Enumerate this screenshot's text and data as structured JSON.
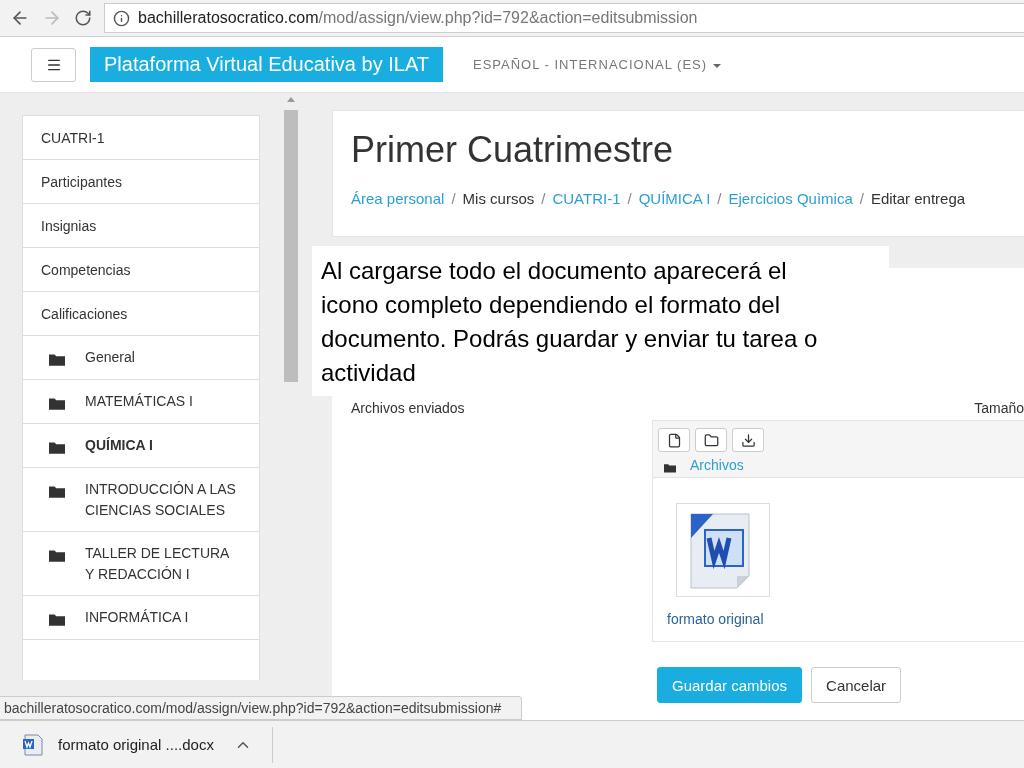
{
  "browser": {
    "url_host": "bachilleratosocratico.com",
    "url_path": "/mod/assign/view.php?id=792&action=editsubmission"
  },
  "header": {
    "site_title": "Plataforma Virtual Educativa by ILAT",
    "language": "ESPAÑOL - INTERNACIONAL (ES)"
  },
  "sidebar": {
    "items": [
      {
        "label": "CUATRI-1",
        "kind": "link",
        "selected": false
      },
      {
        "label": "Participantes",
        "kind": "link",
        "selected": false
      },
      {
        "label": "Insignias",
        "kind": "link",
        "selected": false
      },
      {
        "label": "Competencias",
        "kind": "link",
        "selected": false
      },
      {
        "label": "Calificaciones",
        "kind": "link",
        "selected": false
      },
      {
        "label": "General",
        "kind": "course",
        "selected": false
      },
      {
        "label": "MATEMÁTICAS I",
        "kind": "course",
        "selected": false
      },
      {
        "label": "QUÍMICA I",
        "kind": "course",
        "selected": true
      },
      {
        "label": "INTRODUCCIÓN A LAS CIENCIAS SOCIALES",
        "kind": "course",
        "selected": false
      },
      {
        "label": "TALLER DE LECTURA Y REDACCIÓN I",
        "kind": "course",
        "selected": false
      },
      {
        "label": "INFORMÁTICA I",
        "kind": "course",
        "selected": false
      }
    ]
  },
  "page": {
    "title": "Primer Cuatrimestre",
    "breadcrumb": [
      {
        "label": "Área personal",
        "kind": "link"
      },
      {
        "label": "/",
        "kind": "separator"
      },
      {
        "label": "Mis cursos",
        "kind": "text"
      },
      {
        "label": "/",
        "kind": "separator"
      },
      {
        "label": "CUATRI-1",
        "kind": "link"
      },
      {
        "label": "/",
        "kind": "separator"
      },
      {
        "label": "QUÍMICA I",
        "kind": "link"
      },
      {
        "label": "/",
        "kind": "separator"
      },
      {
        "label": "Ejercicios Quìmica",
        "kind": "link"
      },
      {
        "label": "/",
        "kind": "separator"
      },
      {
        "label": "Editar entrega",
        "kind": "text"
      }
    ]
  },
  "annotation": "Al cargarse todo el documento aparecerá el icono completo dependiendo el formato del documento. Podrás guardar y enviar tu tarea o actividad",
  "form": {
    "files_label": "Archivos enviados",
    "size_label": "Tamaño",
    "folder": "Archivos",
    "files": [
      {
        "name": "formato original"
      }
    ],
    "buttons": [
      {
        "label": "Guardar cambios",
        "kind": "primary"
      },
      {
        "label": "Cancelar",
        "kind": "default"
      }
    ]
  },
  "status_url": "bachilleratosocratico.com/mod/assign/view.php?id=792&action=editsubmission#",
  "downloads": [
    {
      "name": "formato original ....docx"
    }
  ]
}
